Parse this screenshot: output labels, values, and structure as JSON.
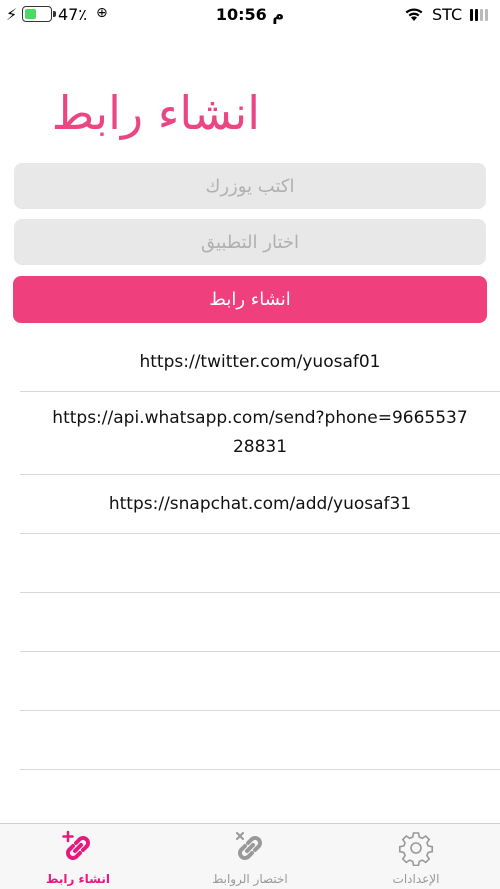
{
  "status_bar": {
    "battery_percent": "47٪",
    "battery_level": 0.47,
    "time": "10:56 م",
    "carrier": "STC"
  },
  "page": {
    "title": "انشاء رابط"
  },
  "form": {
    "username_placeholder": "اكتب يوزرك",
    "app_placeholder": "اختار التطبيق",
    "create_button_label": "انشاء رابط"
  },
  "links": [
    "https://twitter.com/yuosaf01",
    "https://api.whatsapp.com/send?phone=966553728831",
    "https://snapchat.com/add/yuosaf31"
  ],
  "tabs": {
    "create": "انشاء رابط",
    "shorten": "اختصار الروابط",
    "settings": "الإعدادات"
  },
  "colors": {
    "accent": "#ef3f7c",
    "inactive": "#999999"
  }
}
